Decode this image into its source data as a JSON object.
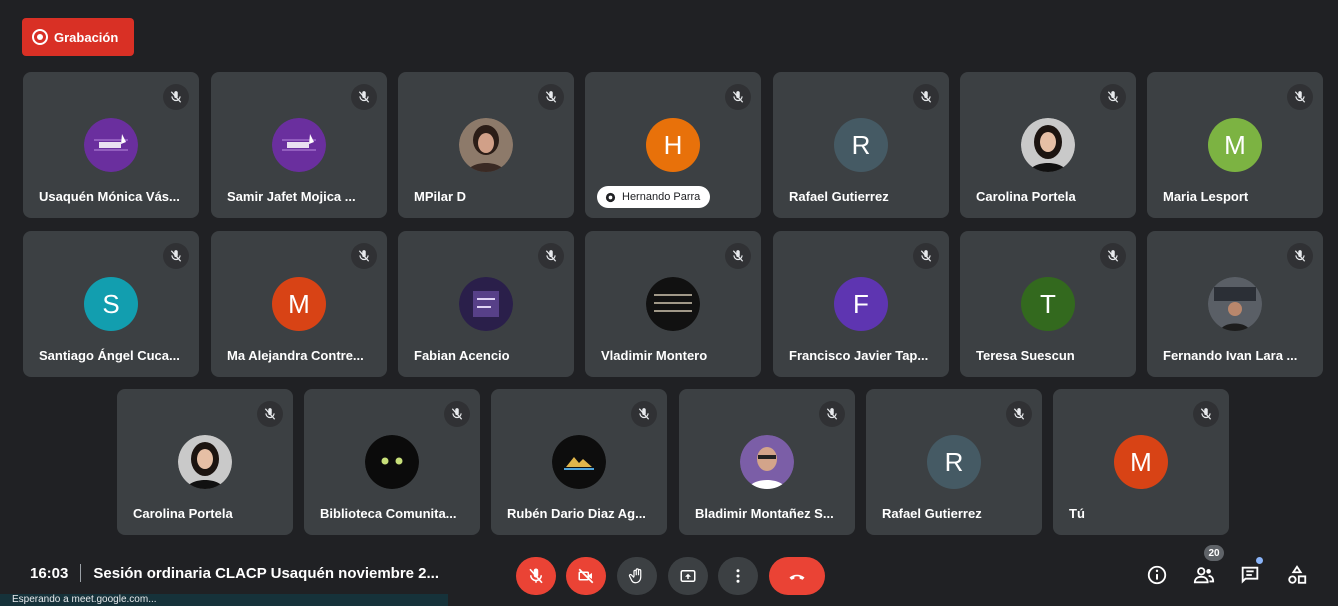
{
  "recording": {
    "label": "Grabación"
  },
  "participants": [
    {
      "name": "Usaquén Mónica Vás...",
      "avatar": "bogota-logo-icon"
    },
    {
      "name": "Samir Jafet Mojica ...",
      "avatar": "bogota-logo-icon"
    },
    {
      "name": "MPilar D",
      "avatar": "photo"
    },
    {
      "name": "Hernando Parra",
      "initial": "H",
      "color": "#e8710a",
      "speaking": true
    },
    {
      "name": "Rafael Gutierrez",
      "initial": "R",
      "color": "#455a64"
    },
    {
      "name": "Carolina Portela",
      "avatar": "photo"
    },
    {
      "name": "Maria Lesport",
      "initial": "M",
      "color": "#7cb342"
    },
    {
      "name": "Santiago Ángel Cuca...",
      "initial": "S",
      "color": "#129eaf"
    },
    {
      "name": "Ma Alejandra Contre...",
      "initial": "M",
      "color": "#d84315"
    },
    {
      "name": "Fabian Acencio",
      "avatar": "photo"
    },
    {
      "name": "Vladimir Montero",
      "avatar": "photo"
    },
    {
      "name": "Francisco Javier Tap...",
      "initial": "F",
      "color": "#5e35b1"
    },
    {
      "name": "Teresa Suescun",
      "initial": "T",
      "color": "#33691e"
    },
    {
      "name": "Fernando Ivan Lara ...",
      "avatar": "photo"
    },
    {
      "name": "Carolina Portela",
      "avatar": "photo"
    },
    {
      "name": "Biblioteca Comunita...",
      "avatar": "cat-icon"
    },
    {
      "name": "Rubén Dario Diaz Ag...",
      "avatar": "photo"
    },
    {
      "name": "Bladimir Montañez S...",
      "avatar": "photo"
    },
    {
      "name": "Rafael Gutierrez",
      "initial": "R",
      "color": "#455a64"
    },
    {
      "name": "Tú",
      "initial": "M",
      "color": "#d84315"
    }
  ],
  "meeting": {
    "time": "16:03",
    "title": "Sesión ordinaria CLACP Usaquén noviembre 2..."
  },
  "people_count": "20",
  "status_text": "Esperando a meet.google.com..."
}
